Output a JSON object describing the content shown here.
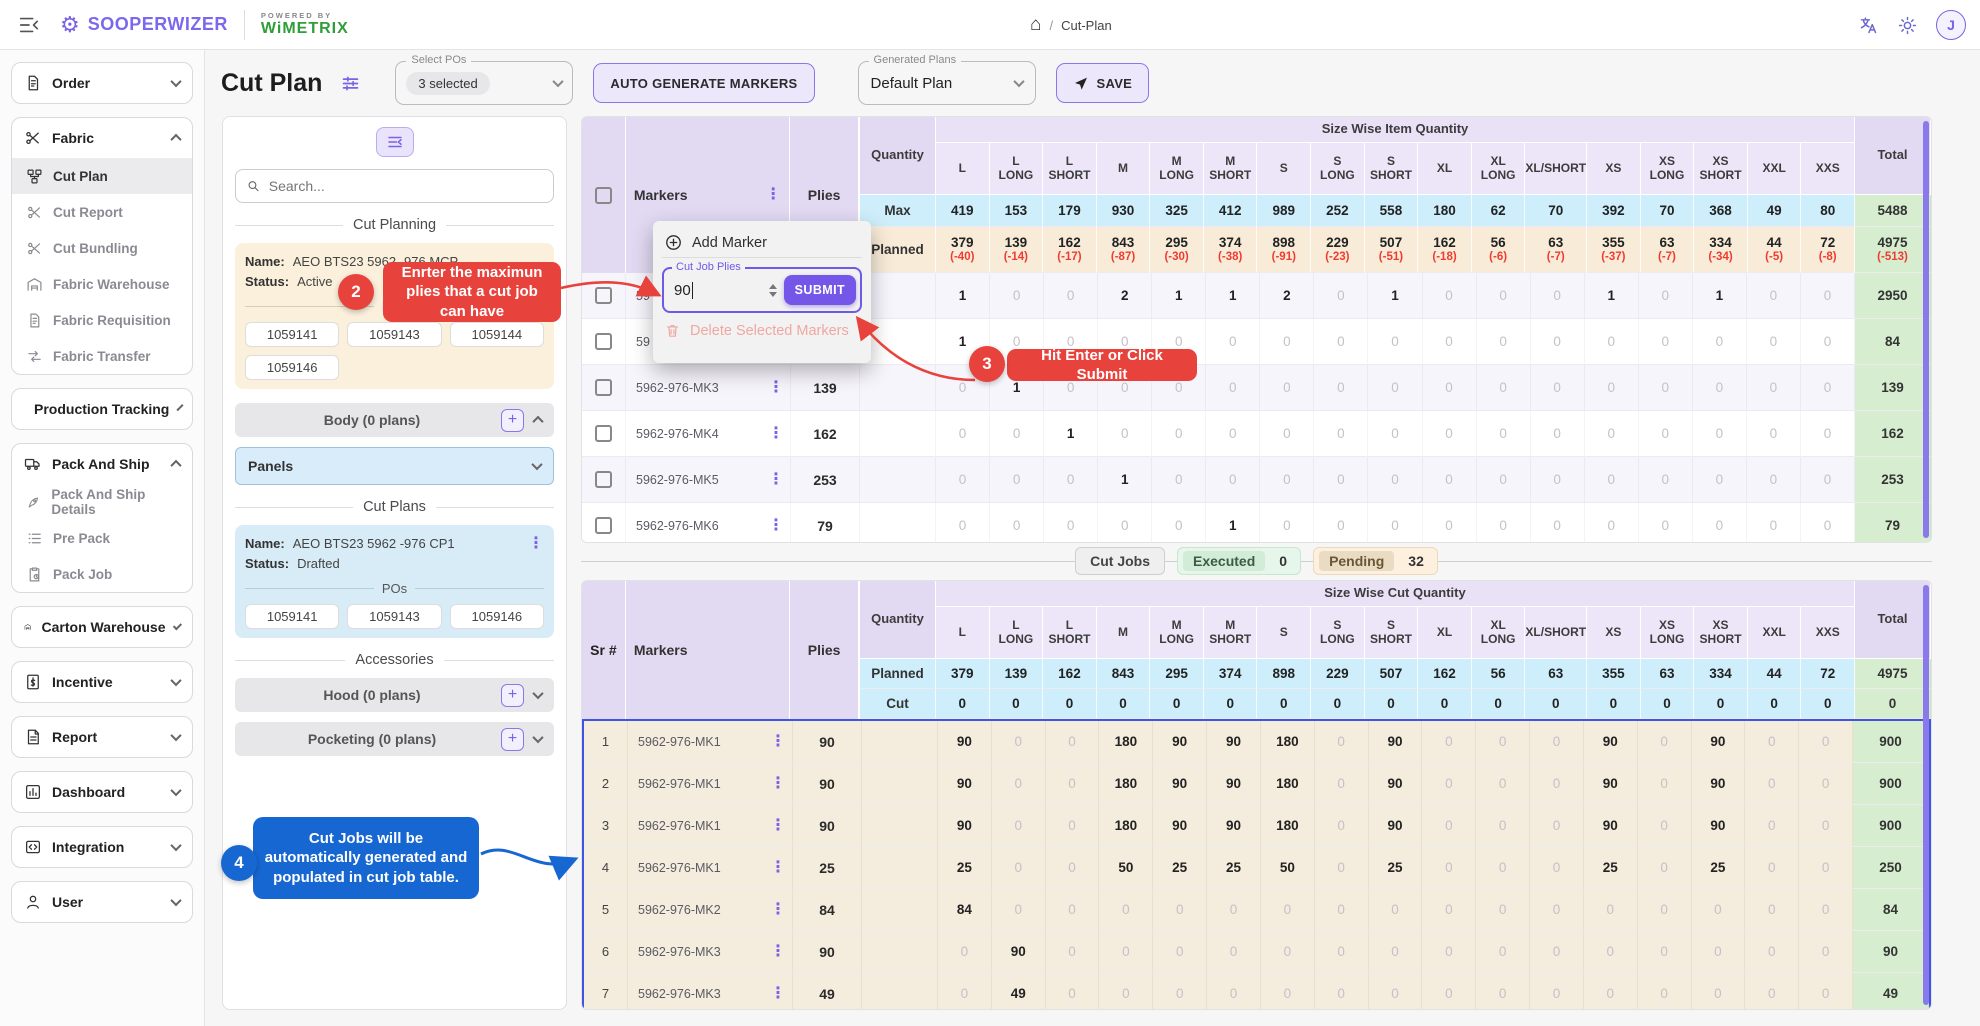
{
  "topbar": {
    "brand": "SOOPERWIZER",
    "powered_by": "POWERED BY",
    "powered_brand": "WiMETRIX",
    "gear_glyph": "⚙",
    "home_glyph": "⌂",
    "breadcrumb_sep": "/",
    "breadcrumb": "Cut-Plan",
    "avatar": "J"
  },
  "sidebar": {
    "groups": [
      {
        "label": "Order",
        "icon": "doc",
        "chev": "down"
      },
      {
        "label": "Fabric",
        "icon": "scissors",
        "chev": "up",
        "items": [
          {
            "label": "Cut Plan",
            "icon": "hierarchy",
            "active": true
          },
          {
            "label": "Cut Report",
            "icon": "scissors"
          },
          {
            "label": "Cut Bundling",
            "icon": "scissors"
          },
          {
            "label": "Fabric Warehouse",
            "icon": "warehouse"
          },
          {
            "label": "Fabric Requisition",
            "icon": "doc"
          },
          {
            "label": "Fabric Transfer",
            "icon": "transfer"
          }
        ]
      },
      {
        "label": "Production Tracking",
        "icon": "clipboardSearch",
        "chev": "down"
      },
      {
        "label": "Pack And Ship",
        "icon": "truck",
        "chev": "up",
        "items": [
          {
            "label": "Pack And Ship Details",
            "icon": "rocket"
          },
          {
            "label": "Pre Pack",
            "icon": "list"
          },
          {
            "label": "Pack Job",
            "icon": "clipboardClock"
          }
        ]
      },
      {
        "label": "Carton Warehouse",
        "icon": "warehouse",
        "chev": "down"
      },
      {
        "label": "Incentive",
        "icon": "dollarDoc",
        "chev": "down"
      },
      {
        "label": "Report",
        "icon": "report",
        "chev": "down"
      },
      {
        "label": "Dashboard",
        "icon": "chart",
        "chev": "down"
      },
      {
        "label": "Integration",
        "icon": "code",
        "chev": "down"
      },
      {
        "label": "User",
        "icon": "user",
        "chev": "down"
      }
    ]
  },
  "page_header": {
    "title": "Cut Plan",
    "select_pos_label": "Select POs",
    "select_pos_value": "3 selected",
    "auto_generate": "AUTO GENERATE MARKERS",
    "generated_plans_label": "Generated Plans",
    "generated_plans_value": "Default Plan",
    "save": "SAVE"
  },
  "left_panel": {
    "search_placeholder": "Search...",
    "cut_planning_divider": "Cut Planning",
    "plan": {
      "name_label": "Name:",
      "name": "AEO BTS23 5962 -976 MCP",
      "status_label": "Status:",
      "status": "Active",
      "pos_divider": "POs",
      "pos": [
        "1059141",
        "1059143",
        "1059144",
        "1059146"
      ]
    },
    "body_section": "Body (0 plans)",
    "panels_select": "Panels",
    "cut_plans_divider": "Cut Plans",
    "cut_plan": {
      "name_label": "Name:",
      "name": "AEO BTS23 5962 -976 CP1",
      "status_label": "Status:",
      "status": "Drafted",
      "pos_divider": "POs",
      "pos": [
        "1059141",
        "1059143",
        "1059146"
      ]
    },
    "accessories_divider": "Accessories",
    "hood_section": "Hood (0 plans)",
    "pocketing_section": "Pocketing (0 plans)"
  },
  "sizes": [
    "L",
    "L LONG",
    "L SHORT",
    "M",
    "M LONG",
    "M SHORT",
    "S",
    "S LONG",
    "S SHORT",
    "XL",
    "XL LONG",
    "XL/SHORT",
    "XS",
    "XS LONG",
    "XS SHORT",
    "XXL",
    "XXS"
  ],
  "item_table": {
    "band_title": "Size Wise Item Quantity",
    "markers_header": "Markers",
    "plies_header": "Plies",
    "quantity_header": "Quantity",
    "total_header": "Total",
    "kebab_glyph": "⋮",
    "max": {
      "label": "Max",
      "values": [
        419,
        153,
        179,
        930,
        325,
        412,
        989,
        252,
        558,
        180,
        62,
        70,
        392,
        70,
        368,
        49,
        80
      ],
      "total": 5488
    },
    "planned": {
      "label": "Planned",
      "values": [
        379,
        139,
        162,
        843,
        295,
        374,
        898,
        229,
        507,
        162,
        56,
        63,
        355,
        63,
        334,
        44,
        72
      ],
      "deltas": [
        "(-40)",
        "(-14)",
        "(-17)",
        "(-87)",
        "(-30)",
        "(-38)",
        "(-91)",
        "(-23)",
        "(-51)",
        "(-18)",
        "(-6)",
        "(-7)",
        "(-37)",
        "(-7)",
        "(-34)",
        "(-5)",
        "(-8)"
      ],
      "total": 4975,
      "total_delta": "(-513)"
    },
    "rows": [
      {
        "marker": "59",
        "plies": "",
        "values": [
          1,
          0,
          0,
          2,
          1,
          1,
          2,
          0,
          1,
          0,
          0,
          0,
          1,
          0,
          1,
          0,
          0
        ],
        "total": 2950
      },
      {
        "marker": "59",
        "plies": "",
        "values": [
          1,
          0,
          0,
          0,
          0,
          0,
          0,
          0,
          0,
          0,
          0,
          0,
          0,
          0,
          0,
          0,
          0
        ],
        "total": 84
      },
      {
        "marker": "5962-976-MK3",
        "plies": 139,
        "values": [
          0,
          1,
          0,
          0,
          0,
          0,
          0,
          0,
          0,
          0,
          0,
          0,
          0,
          0,
          0,
          0,
          0
        ],
        "total": 139
      },
      {
        "marker": "5962-976-MK4",
        "plies": 162,
        "values": [
          0,
          0,
          1,
          0,
          0,
          0,
          0,
          0,
          0,
          0,
          0,
          0,
          0,
          0,
          0,
          0,
          0
        ],
        "total": 162
      },
      {
        "marker": "5962-976-MK5",
        "plies": 253,
        "values": [
          0,
          0,
          0,
          1,
          0,
          0,
          0,
          0,
          0,
          0,
          0,
          0,
          0,
          0,
          0,
          0,
          0
        ],
        "total": 253
      },
      {
        "marker": "5962-976-MK6",
        "plies": 79,
        "values": [
          0,
          0,
          0,
          0,
          0,
          1,
          0,
          0,
          0,
          0,
          0,
          0,
          0,
          0,
          0,
          0,
          0
        ],
        "total": 79
      }
    ]
  },
  "cut_jobs_bar": {
    "jobs": "Cut Jobs",
    "executed_label": "Executed",
    "executed_count": "0",
    "pending_label": "Pending",
    "pending_count": "32"
  },
  "cut_table": {
    "band_title": "Size Wise Cut Quantity",
    "sr_header": "Sr #",
    "markers_header": "Markers",
    "plies_header": "Plies",
    "quantity_header": "Quantity",
    "total_header": "Total",
    "planned": {
      "label": "Planned",
      "values": [
        379,
        139,
        162,
        843,
        295,
        374,
        898,
        229,
        507,
        162,
        56,
        63,
        355,
        63,
        334,
        44,
        72
      ],
      "total": 4975
    },
    "cut": {
      "label": "Cut",
      "values": [
        0,
        0,
        0,
        0,
        0,
        0,
        0,
        0,
        0,
        0,
        0,
        0,
        0,
        0,
        0,
        0,
        0
      ],
      "total": 0
    },
    "rows": [
      {
        "sr": 1,
        "marker": "5962-976-MK1",
        "plies": 90,
        "values": [
          90,
          0,
          0,
          180,
          90,
          90,
          180,
          0,
          90,
          0,
          0,
          0,
          90,
          0,
          90,
          0,
          0
        ],
        "total": 900
      },
      {
        "sr": 2,
        "marker": "5962-976-MK1",
        "plies": 90,
        "values": [
          90,
          0,
          0,
          180,
          90,
          90,
          180,
          0,
          90,
          0,
          0,
          0,
          90,
          0,
          90,
          0,
          0
        ],
        "total": 900
      },
      {
        "sr": 3,
        "marker": "5962-976-MK1",
        "plies": 90,
        "values": [
          90,
          0,
          0,
          180,
          90,
          90,
          180,
          0,
          90,
          0,
          0,
          0,
          90,
          0,
          90,
          0,
          0
        ],
        "total": 900
      },
      {
        "sr": 4,
        "marker": "5962-976-MK1",
        "plies": 25,
        "values": [
          25,
          0,
          0,
          50,
          25,
          25,
          50,
          0,
          25,
          0,
          0,
          0,
          25,
          0,
          25,
          0,
          0
        ],
        "total": 250
      },
      {
        "sr": 5,
        "marker": "5962-976-MK2",
        "plies": 84,
        "values": [
          84,
          0,
          0,
          0,
          0,
          0,
          0,
          0,
          0,
          0,
          0,
          0,
          0,
          0,
          0,
          0,
          0
        ],
        "total": 84
      },
      {
        "sr": 6,
        "marker": "5962-976-MK3",
        "plies": 90,
        "values": [
          0,
          90,
          0,
          0,
          0,
          0,
          0,
          0,
          0,
          0,
          0,
          0,
          0,
          0,
          0,
          0,
          0
        ],
        "total": 90
      },
      {
        "sr": 7,
        "marker": "5962-976-MK3",
        "plies": 49,
        "values": [
          0,
          49,
          0,
          0,
          0,
          0,
          0,
          0,
          0,
          0,
          0,
          0,
          0,
          0,
          0,
          0,
          0
        ],
        "total": 49
      }
    ]
  },
  "popup": {
    "add_marker": "Add Marker",
    "add_glyph": "⊕",
    "cut_job_plies_label": "Cut Job Plies",
    "plies_value": "90",
    "submit": "SUBMIT",
    "delete": "Delete Selected Markers"
  },
  "annotations": {
    "step2": {
      "badge": "2",
      "text": "Enrter the maximun plies that a cut job can have"
    },
    "step3": {
      "badge": "3",
      "text": "Hit Enter or Click Submit"
    },
    "step4": {
      "badge": "4",
      "text": "Cut Jobs will be automatically generated and populated in cut job table."
    }
  },
  "colors": {
    "accent": "#7b61e6",
    "brand_green": "#2f9e38",
    "annotation_red": "#e8423c",
    "annotation_blue": "#1767d2",
    "max_row": "#cdeefa",
    "planned_row": "#f8ecd8",
    "total_col": "#d6eecf",
    "table_header": "#e2daf2",
    "cut_body_border": "#3d55e0"
  }
}
